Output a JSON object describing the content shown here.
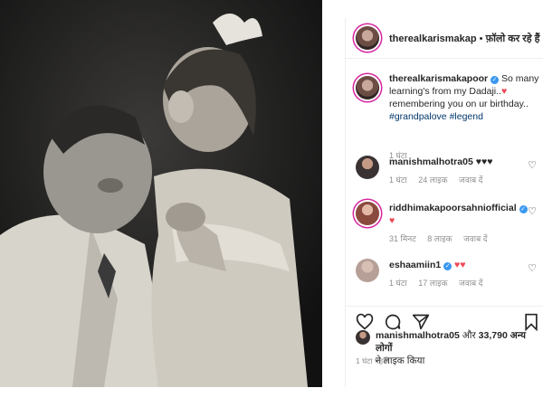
{
  "header": {
    "username": "therealkarismakap",
    "separator": " • ",
    "follow_label": "फ़ॉलो कर रहे हैं"
  },
  "caption": {
    "username": "therealkarismakapoor",
    "verified_mark": "✓",
    "text": "So many learning's from my Dadaji..",
    "text2": "remembering you on ur birthday..",
    "heart": "♥",
    "hashtags": [
      "#grandpalove",
      "#legend"
    ],
    "time": "1 घंटा"
  },
  "comments": [
    {
      "username": "manishmalhotra05",
      "text": "♥♥♥",
      "time": "1 घंटा",
      "likes": "24 लाइक",
      "reply": "जवाब दें"
    },
    {
      "username": "riddhimakapoorsahniofficial",
      "text": "♥",
      "time": "31 मिनट",
      "likes": "8 लाइक",
      "reply": "जवाब दें"
    },
    {
      "username": "eshaamiin1",
      "text": "♥♥",
      "time": "1 घंटा",
      "likes": "17 लाइक",
      "reply": "जवाब दें"
    }
  ],
  "likes": {
    "user": "manishmalhotra05",
    "text_mid": " और ",
    "count_text": "33,790 अन्य लोगों",
    "text_end": "ने लाइक किया"
  },
  "post_time": "1 घंटा पहले",
  "icons": [
    "like-heart-icon",
    "comment-bubble-icon",
    "share-plane-icon",
    "save-bookmark-icon",
    "comment-like-heart-icon"
  ],
  "colors": {
    "verified": "#3897f0",
    "heart": "#ed4956",
    "story_ring": "#d6249f",
    "hashtag": "#00376b"
  }
}
